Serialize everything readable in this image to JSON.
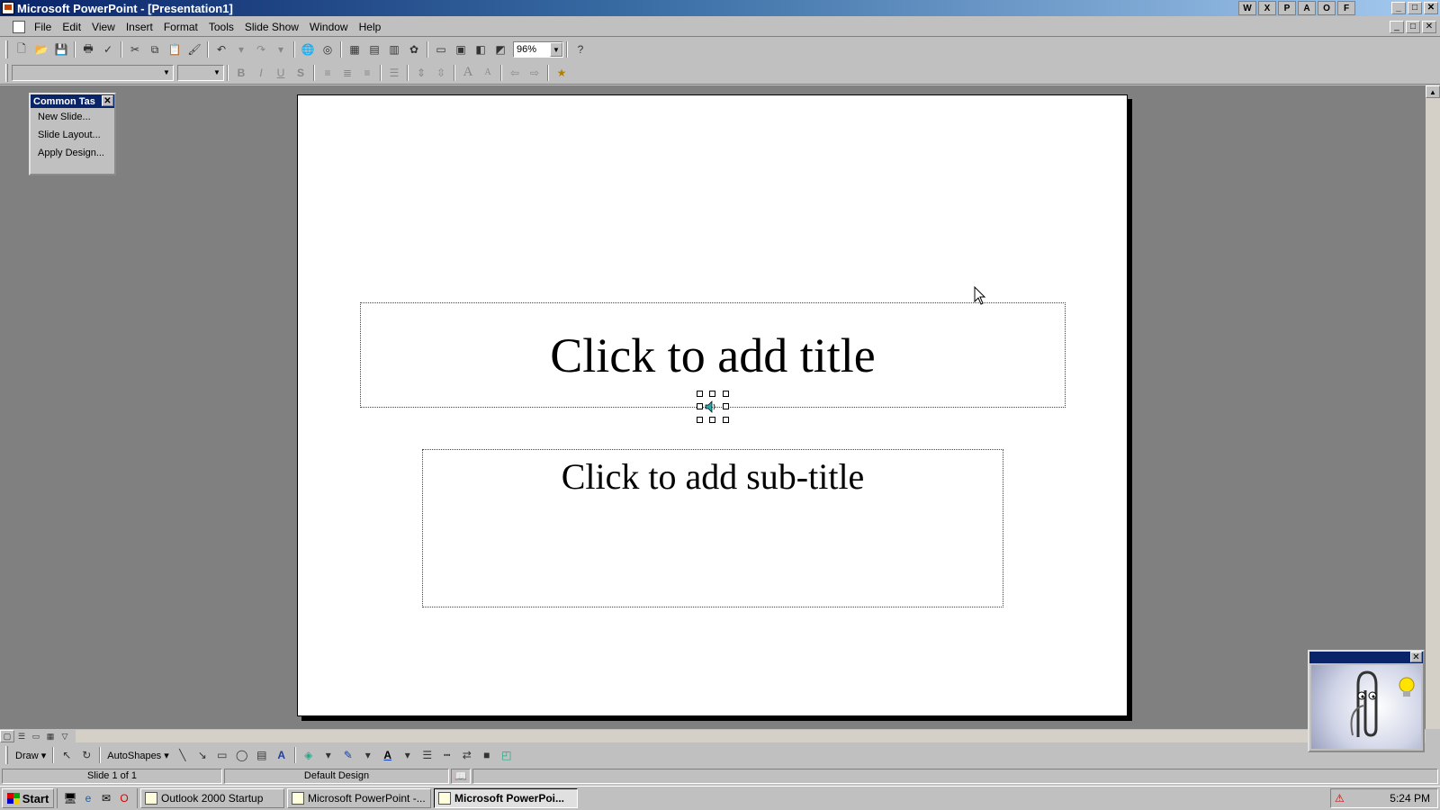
{
  "window": {
    "title": "Microsoft PowerPoint - [Presentation1]",
    "buttons": {
      "minimize": "_",
      "maximize": "□",
      "close": "✕"
    }
  },
  "office_shortcuts": [
    "W",
    "X",
    "P",
    "A",
    "O",
    "F"
  ],
  "menu": {
    "items": [
      "File",
      "Edit",
      "View",
      "Insert",
      "Format",
      "Tools",
      "Slide Show",
      "Window",
      "Help"
    ]
  },
  "standard_toolbar": {
    "zoom": "96%",
    "icons": [
      "new-icon",
      "open-icon",
      "save-icon",
      "print-icon",
      "spelling-icon",
      "cut-icon",
      "copy-icon",
      "paste-icon",
      "format-painter-icon",
      "undo-icon",
      "redo-icon",
      "hyperlink-icon",
      "web-toolbar-icon",
      "insert-table-icon",
      "insert-word-table-icon",
      "insert-chart-icon",
      "insert-clipart-icon",
      "new-slide-icon",
      "slide-layout-icon",
      "apply-design-icon",
      "grayscale-icon",
      "help-icon"
    ]
  },
  "formatting_toolbar": {
    "font_name": "",
    "font_size": "",
    "bold": "B",
    "italic": "I",
    "underline": "U",
    "shadow": "S"
  },
  "common_tasks": {
    "title": "Common Tas",
    "items": [
      "New Slide...",
      "Slide Layout...",
      "Apply Design..."
    ]
  },
  "slide": {
    "title_placeholder": "Click to add title",
    "subtitle_placeholder": "Click to add sub-title"
  },
  "drawing_toolbar": {
    "draw_label": "Draw",
    "autoshapes_label": "AutoShapes"
  },
  "status": {
    "slide_info": "Slide 1 of 1",
    "design": "Default Design"
  },
  "taskbar": {
    "start": "Start",
    "tasks": [
      "Outlook 2000 Startup",
      "Microsoft PowerPoint -...",
      "Microsoft PowerPoi..."
    ],
    "clock": "5:24 PM"
  },
  "colors": {
    "titlebar_start": "#0a246a",
    "titlebar_end": "#a6caf0",
    "workspace": "#808080",
    "chrome": "#c0c0c0"
  }
}
